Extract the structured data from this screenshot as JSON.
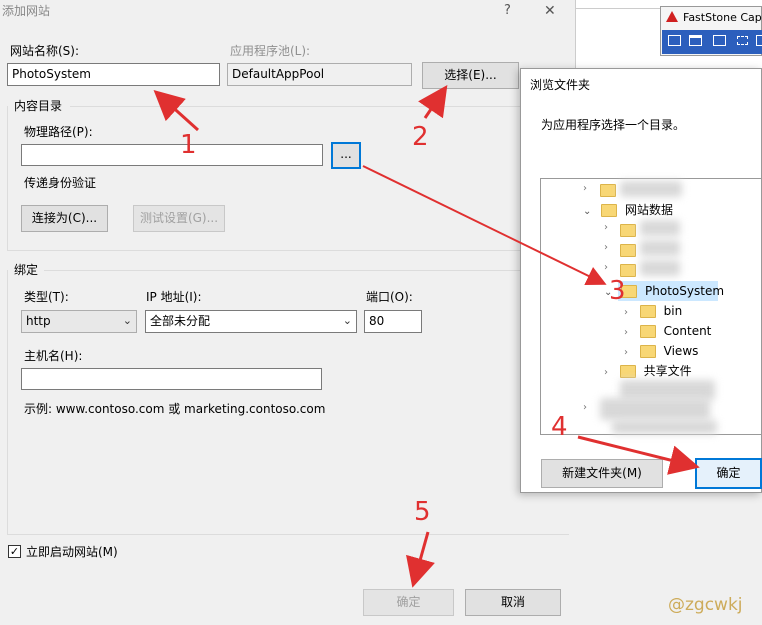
{
  "dialog": {
    "title": "添加网站",
    "help_icon": "?",
    "close_icon": "✕",
    "site_name_label": "网站名称(S):",
    "site_name_value": "PhotoSystem",
    "app_pool_label": "应用程序池(L):",
    "app_pool_value": "DefaultAppPool",
    "select_button": "选择(E)...",
    "content_dir_label": "内容目录",
    "physical_path_label": "物理路径(P):",
    "physical_path_value": "",
    "browse_button": "...",
    "pass_through_label": "传递身份验证",
    "connect_as_button": "连接为(C)...",
    "test_settings_button": "测试设置(G)...",
    "binding_label": "绑定",
    "type_label": "类型(T):",
    "type_value": "http",
    "ip_label": "IP 地址(I):",
    "ip_value": "全部未分配",
    "port_label": "端口(O):",
    "port_value": "80",
    "hostname_label": "主机名(H):",
    "hostname_value": "",
    "example_text": "示例: www.contoso.com 或 marketing.contoso.com",
    "start_site_label": "立即启动网站(M)",
    "start_site_checked": true,
    "ok_button": "确定",
    "cancel_button": "取消"
  },
  "browse_dialog": {
    "title": "浏览文件夹",
    "description": "为应用程序选择一个目录。",
    "tree": [
      {
        "label": "网站数据",
        "expanded": true
      },
      {
        "label": "PhotoSystem",
        "expanded": true,
        "selected": true
      },
      {
        "label": "bin"
      },
      {
        "label": "Content"
      },
      {
        "label": "Views"
      },
      {
        "label": "共享文件"
      }
    ],
    "new_folder_button": "新建文件夹(M)",
    "ok_button": "确定"
  },
  "faststone": {
    "title": "FastStone Captu"
  },
  "annotations": [
    "1",
    "2",
    "3",
    "4",
    "5"
  ],
  "watermark": "@zgcwkj",
  "colors": {
    "arrow": "#e03030",
    "selection": "#cce8ff",
    "accent": "#0078d7"
  }
}
